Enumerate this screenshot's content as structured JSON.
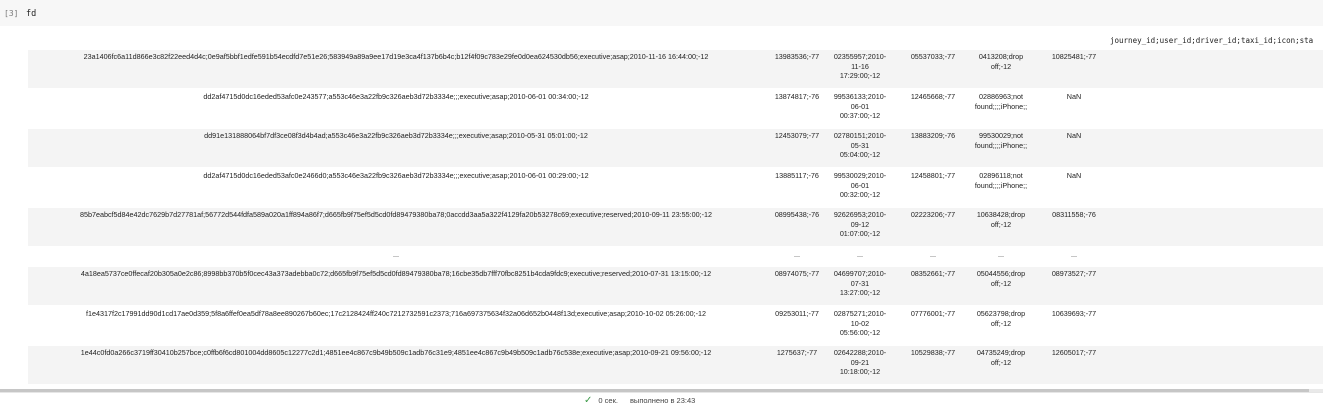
{
  "cell": {
    "prompt": "[3]",
    "code": "fd"
  },
  "table": {
    "header": "journey_id;user_id;driver_id;taxi_id;icon;sta",
    "rows": [
      [
        "23a1406fc6a11d866e3c82f22eed4d4c;0e9af5bbf1edfe591b54ecdfd7e51e26;583949a89a9ee17d19e3ca4f137b6b4c;b12f4f09c783e29fe0d0ea624530db56;executive;asap;2010-11-16 16:44:00;-12",
        "13983536;-77",
        "02355957;2010-11-16 17:29:00;-12",
        "05537033;-77",
        "0413208;drop off;-12",
        "10825481;-77"
      ],
      [
        "dd2af4715d0dc16eded53afc0e243577;a553c46e3a22fb9c326aeb3d72b3334e;;;executive;asap;2010-06-01 00:34:00;-12",
        "13874817;-76",
        "99536133;2010-06-01 00:37:00;-12",
        "12465668;-77",
        "02886963;not found;;;;iPhone;;",
        "NaN"
      ],
      [
        "dd91e131888064bf7df3ce08f3d4b4ad;a553c46e3a22fb9c326aeb3d72b3334e;;;executive;asap;2010-05-31 05:01:00;-12",
        "12453079;-77",
        "02780151;2010-05-31 05:04:00;-12",
        "13883209;-76",
        "99530029;not found;;;;iPhone;;",
        "NaN"
      ],
      [
        "dd2af4715d0dc16eded53afc0e2466d0;a553c46e3a22fb9c326aeb3d72b3334e;;;executive;asap;2010-06-01 00:29:00;-12",
        "13885117;-76",
        "99530029;2010-06-01 00:32:00;-12",
        "12458801;-77",
        "02896118;not found;;;;iPhone;;",
        "NaN"
      ],
      [
        "85b7eabcf5d84e42dc7629b7d27781af;56772d544fdfa589a020a1ff894a86f7;d665fb9f75ef5d5cd0fd89479380ba78;0accdd3aa5a322f4129fa20b53278c69;executive;reserved;2010-09-11 23:55:00;-12",
        "08995438;-76",
        "92626953;2010-09-12 01:07:00;-12",
        "02223206;-77",
        "10638428;drop off;-12",
        "08311558;-76"
      ],
      [
        "...",
        "...",
        "...",
        "...",
        "...",
        "..."
      ],
      [
        "4a18ea5737ce0ffecaf20b305a0e2c86;8998bb370b5f0cec43a373adebba0c72;d665fb9f75ef5d5cd0fd89479380ba78;16cbe35db7fff70fbc8251b4cda9fdc9;executive;reserved;2010-07-31 13:15:00;-12",
        "08974075;-77",
        "04699707;2010-07-31 13:27:00;-12",
        "08352661;-77",
        "05044556;drop off;-12",
        "08973527;-77"
      ],
      [
        "f1e4317f2c17991dd90d1cd17ae0d359;5f8a6ffef0ea5df78a8ee890267b60ec;17c2128424ff240c7212732591c2373;716a697375634f32a06d652b0448f13d;executive;asap;2010-10-02 05:26:00;-12",
        "09253011;-77",
        "02875271;2010-10-02 05:56:00;-12",
        "07776001;-77",
        "05623798;drop off;-12",
        "10639693;-77"
      ],
      [
        "1e44c0fd0a266c3719ff30410b257bce;c0ffb6f6cd801004dd8605c12277c2d1;4851ee4c867c9b49b509c1adb76c31e9;4851ee4c867c9b49b509c1adb76c538e;executive;asap;2010-09-21 09:56:00;-12",
        "1275637;-77",
        "02642288;2010-09-21 10:18:00;-12",
        "10529838;-77",
        "04735249;drop off;-12",
        "12605017;-77"
      ]
    ]
  },
  "status": {
    "duration": "0 сек.",
    "completed": "выполнено в 23:43"
  },
  "colors": {
    "check": "#3d9a48",
    "stripe": "#f4f4f4"
  },
  "icons": [
    "check-icon"
  ]
}
